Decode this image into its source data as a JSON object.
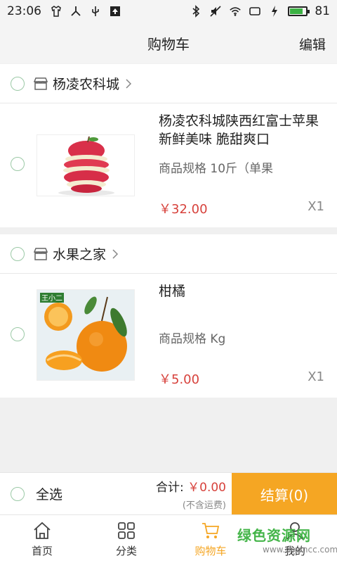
{
  "status_bar": {
    "time": "23:06",
    "battery": "81"
  },
  "nav": {
    "title": "购物车",
    "edit_label": "编辑"
  },
  "stores": [
    {
      "name": "杨凌农科城",
      "item": {
        "name": "杨凌农科城陕西红富士苹果新鲜美味 脆甜爽口",
        "spec": "商品规格  10斤（单果",
        "price": "￥32.00",
        "qty": "X1"
      }
    },
    {
      "name": "水果之家",
      "item": {
        "name": "柑橘",
        "spec": "商品规格  Kg",
        "price": "￥5.00",
        "qty": "X1",
        "thumb_badge": "王小二"
      }
    }
  ],
  "checkout": {
    "select_all": "全选",
    "total_label": "合计:",
    "total_amount": "￥0.00",
    "shipping_note": "(不含运费)",
    "pay_label": "结算(0)"
  },
  "tabs": [
    {
      "label": "首页",
      "icon": "home-icon"
    },
    {
      "label": "分类",
      "icon": "grid-icon"
    },
    {
      "label": "购物车",
      "icon": "cart-icon",
      "active": true
    },
    {
      "label": "我的",
      "icon": "user-icon"
    }
  ],
  "watermark": {
    "line1": "绿色资源网",
    "line2": "www.downcc.com"
  },
  "colors": {
    "accent": "#f5a623",
    "price": "#d7423c",
    "radio": "#9bc9a6"
  }
}
